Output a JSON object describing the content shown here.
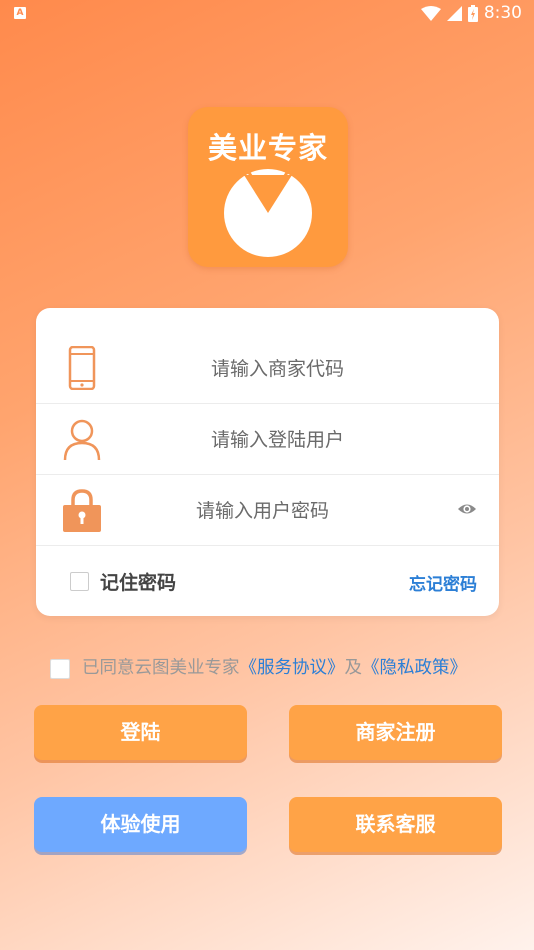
{
  "status_bar": {
    "time": "8:30",
    "notification_icon": "A"
  },
  "logo": {
    "title": "美业专家"
  },
  "form": {
    "merchant_placeholder": "请输入商家代码",
    "user_placeholder": "请输入登陆用户",
    "password_placeholder": "请输入用户密码",
    "remember_label": "记住密码",
    "forgot_label": "忘记密码"
  },
  "agreement": {
    "prefix": "已同意云图美业专家",
    "service_link": "《服务协议》",
    "conjunction": "及",
    "privacy_link": "《隐私政策》"
  },
  "buttons": {
    "login": "登陆",
    "register": "商家注册",
    "trial": "体验使用",
    "contact": "联系客服"
  },
  "colors": {
    "accent": "#ffa347",
    "link": "#2c7fd6",
    "trial_button": "#6ea9ff"
  }
}
